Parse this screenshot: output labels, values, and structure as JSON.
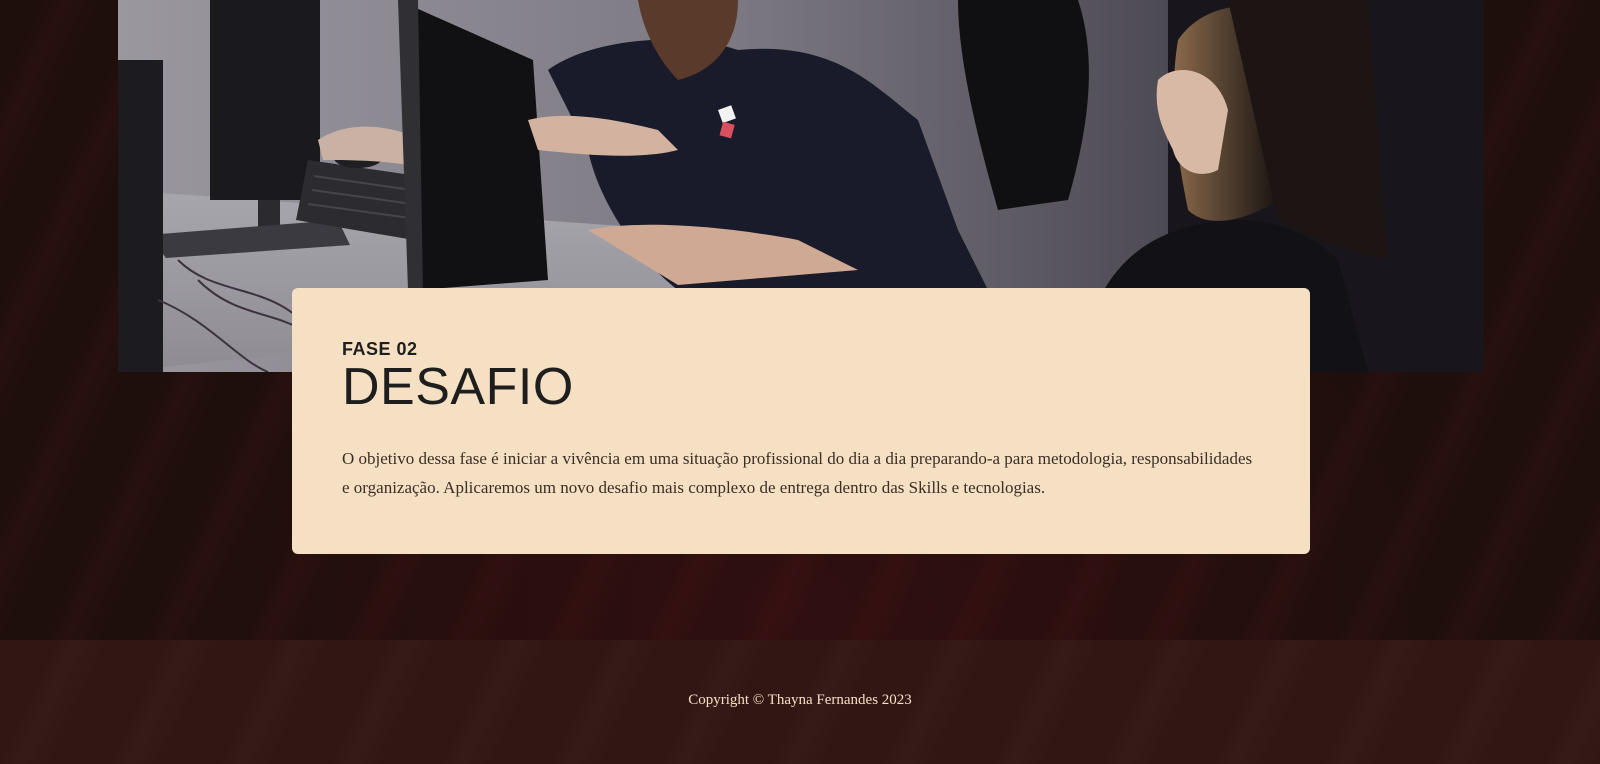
{
  "colors": {
    "page_bg": "#1f0f0b",
    "card_bg": "#f6e0c3",
    "footer_bg": "#311614",
    "footer_text": "#f6e0c3",
    "heading_text": "#1e1e1e"
  },
  "hero": {
    "image_icon": "team-at-computers-photo"
  },
  "phase_card": {
    "eyebrow": "FASE 02",
    "title": "DESAFIO",
    "description": "O objetivo dessa fase é iniciar a vivência em uma situação profissional do dia a dia preparando-a para metodologia, responsabilidades e organização. Aplicaremos um novo desafio mais complexo de entrega dentro das Skills e tecnologias."
  },
  "footer": {
    "copyright": "Copyright © Thayna Fernandes 2023"
  }
}
